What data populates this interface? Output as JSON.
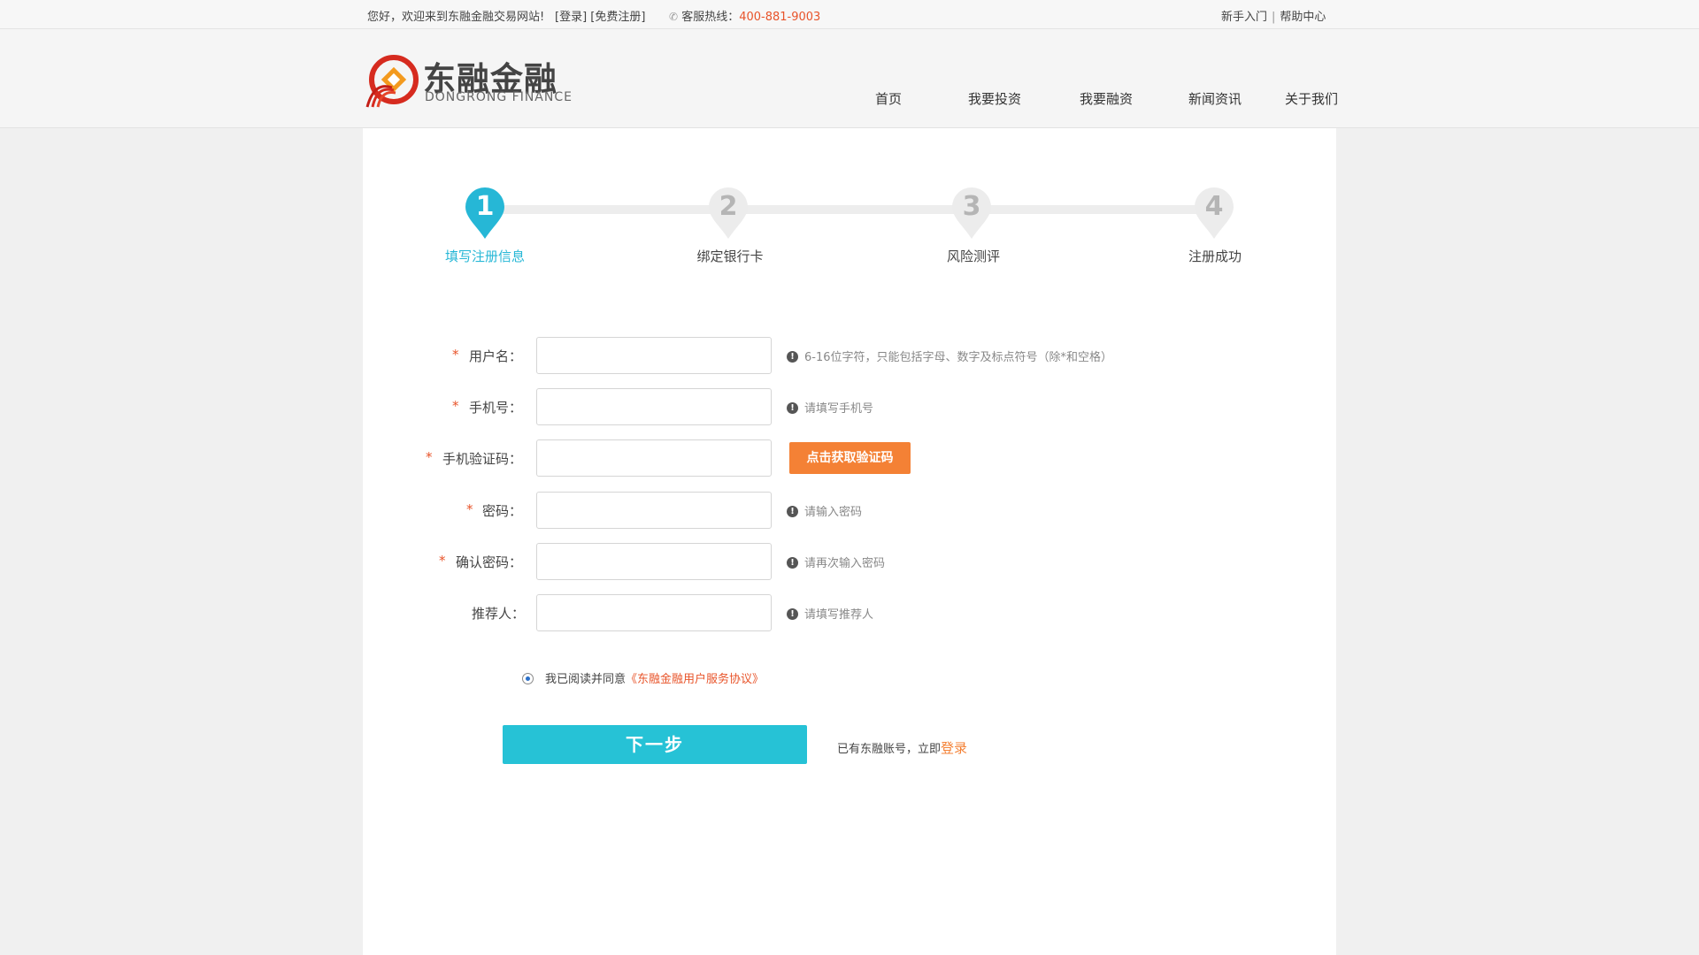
{
  "topbar": {
    "welcome": "您好，欢迎来到东融金融交易网站!",
    "login": "[登录]",
    "register": "[免费注册]",
    "hotline_label": "客服热线：",
    "hotline_number": "400-881-9003",
    "beginner": "新手入门",
    "separator": "|",
    "help": "帮助中心"
  },
  "logo": {
    "cn": "东融金融",
    "en": "DONGRONG FINANCE"
  },
  "nav": {
    "items": [
      "首页",
      "我要投资",
      "我要融资",
      "新闻资讯",
      "关于我们"
    ]
  },
  "steps": [
    {
      "number": "1",
      "label": "填写注册信息",
      "active": true
    },
    {
      "number": "2",
      "label": "绑定银行卡",
      "active": false
    },
    {
      "number": "3",
      "label": "风险测评",
      "active": false
    },
    {
      "number": "4",
      "label": "注册成功",
      "active": false
    }
  ],
  "form": {
    "required_mark": "*",
    "username_label": "用户名：",
    "username_hint": "6-16位字符，只能包括字母、数字及标点符号（除*和空格）",
    "phone_label": "手机号：",
    "phone_hint": "请填写手机号",
    "sms_label": "手机验证码：",
    "sms_button": "点击获取验证码",
    "password_label": "密码：",
    "password_hint": "请输入密码",
    "confirm_label": "确认密码：",
    "confirm_hint": "请再次输入密码",
    "referrer_label": "推荐人：",
    "referrer_hint": "请填写推荐人",
    "info_icon_glyph": "!"
  },
  "agreement": {
    "text": "我已阅读并同意",
    "link": "《东融金融用户服务协议》"
  },
  "actions": {
    "next": "下一步",
    "login_prompt": "已有东融账号，立即",
    "login_link": "登录"
  },
  "colors": {
    "accent_teal": "#26c2d6",
    "accent_orange": "#f48135",
    "accent_red": "#e8542a"
  }
}
